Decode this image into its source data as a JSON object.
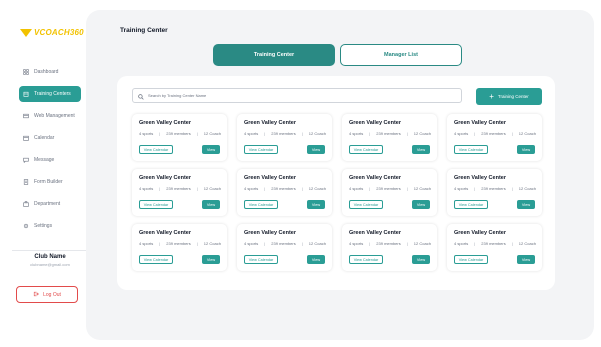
{
  "brand": {
    "logo_text": "VCOACH360",
    "accent": "#f2c200",
    "teal": "#2a9d95"
  },
  "sidebar": {
    "items": [
      {
        "label": "Dashboard",
        "icon": "grid-icon",
        "active": false
      },
      {
        "label": "Training Centers",
        "icon": "building-icon",
        "active": true
      },
      {
        "label": "Web Management",
        "icon": "web-icon",
        "active": false
      },
      {
        "label": "Calendar",
        "icon": "calendar-icon",
        "active": false
      },
      {
        "label": "Message",
        "icon": "message-icon",
        "active": false
      },
      {
        "label": "Form Builder",
        "icon": "form-icon",
        "active": false
      },
      {
        "label": "Department",
        "icon": "department-icon",
        "active": false
      },
      {
        "label": "Settings",
        "icon": "gear-icon",
        "active": false
      }
    ],
    "club_name": "Club Name",
    "club_email": "clubname@gmail.com",
    "logout_label": "Log Out"
  },
  "header": {
    "title": "Training Center"
  },
  "tabs": [
    {
      "label": "Training Center",
      "active": true
    },
    {
      "label": "Manager List",
      "active": false
    }
  ],
  "search": {
    "placeholder": "Search by Training Center Name"
  },
  "add_button": {
    "label": "Training Center"
  },
  "cards": [
    {
      "title": "Green Valley Center",
      "sports": "4 sports",
      "members": "239 members",
      "coaches": "12 Coach",
      "calendar_label": "View Calendar",
      "view_label": "View"
    },
    {
      "title": "Green Valley Center",
      "sports": "4 sports",
      "members": "239 members",
      "coaches": "12 Coach",
      "calendar_label": "View Calendar",
      "view_label": "View"
    },
    {
      "title": "Green Valley Center",
      "sports": "4 sports",
      "members": "239 members",
      "coaches": "12 Coach",
      "calendar_label": "View Calendar",
      "view_label": "View"
    },
    {
      "title": "Green Valley Center",
      "sports": "4 sports",
      "members": "239 members",
      "coaches": "12 Coach",
      "calendar_label": "View Calendar",
      "view_label": "View"
    },
    {
      "title": "Green Valley Center",
      "sports": "4 sports",
      "members": "239 members",
      "coaches": "12 Coach",
      "calendar_label": "View Calendar",
      "view_label": "View"
    },
    {
      "title": "Green Valley Center",
      "sports": "4 sports",
      "members": "239 members",
      "coaches": "12 Coach",
      "calendar_label": "View Calendar",
      "view_label": "View"
    },
    {
      "title": "Green Valley Center",
      "sports": "4 sports",
      "members": "239 members",
      "coaches": "12 Coach",
      "calendar_label": "View Calendar",
      "view_label": "View"
    },
    {
      "title": "Green Valley Center",
      "sports": "4 sports",
      "members": "239 members",
      "coaches": "12 Coach",
      "calendar_label": "View Calendar",
      "view_label": "View"
    },
    {
      "title": "Green Valley Center",
      "sports": "4 sports",
      "members": "239 members",
      "coaches": "12 Coach",
      "calendar_label": "View Calendar",
      "view_label": "View"
    },
    {
      "title": "Green Valley Center",
      "sports": "4 sports",
      "members": "239 members",
      "coaches": "12 Coach",
      "calendar_label": "View Calendar",
      "view_label": "View"
    },
    {
      "title": "Green Valley Center",
      "sports": "4 sports",
      "members": "239 members",
      "coaches": "12 Coach",
      "calendar_label": "View Calendar",
      "view_label": "View"
    },
    {
      "title": "Green Valley Center",
      "sports": "4 sports",
      "members": "239 members",
      "coaches": "12 Coach",
      "calendar_label": "View Calendar",
      "view_label": "View"
    }
  ]
}
